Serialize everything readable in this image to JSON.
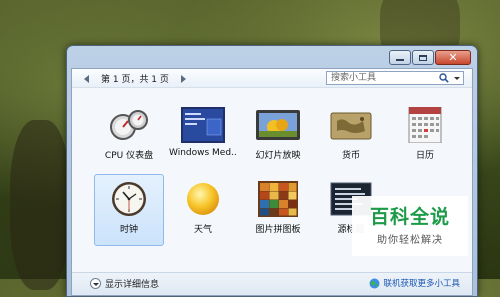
{
  "window": {
    "pager_text": "第 1 页，共 1 页",
    "search_placeholder": "搜索小工具"
  },
  "gadgets": [
    {
      "label": "CPU 仪表盘",
      "icon": "cpu-meter-icon",
      "selected": false
    },
    {
      "label": "Windows Med...",
      "icon": "media-center-icon",
      "selected": false
    },
    {
      "label": "幻灯片放映",
      "icon": "slideshow-icon",
      "selected": false
    },
    {
      "label": "货币",
      "icon": "currency-icon",
      "selected": false
    },
    {
      "label": "日历",
      "icon": "calendar-icon",
      "selected": false
    },
    {
      "label": "时钟",
      "icon": "clock-icon",
      "selected": true
    },
    {
      "label": "天气",
      "icon": "weather-icon",
      "selected": false
    },
    {
      "label": "图片拼图板",
      "icon": "puzzle-icon",
      "selected": false
    },
    {
      "label": "源标题",
      "icon": "feed-headlines-icon",
      "selected": false
    }
  ],
  "footer": {
    "details_label": "显示详细信息",
    "online_link": "联机获取更多小工具"
  },
  "watermark": {
    "title": "百科全说",
    "subtitle": "助你轻松解决"
  },
  "colors": {
    "selection": "#cbe3fb",
    "link": "#1b56b4",
    "watermark_green": "#1d9b48"
  }
}
